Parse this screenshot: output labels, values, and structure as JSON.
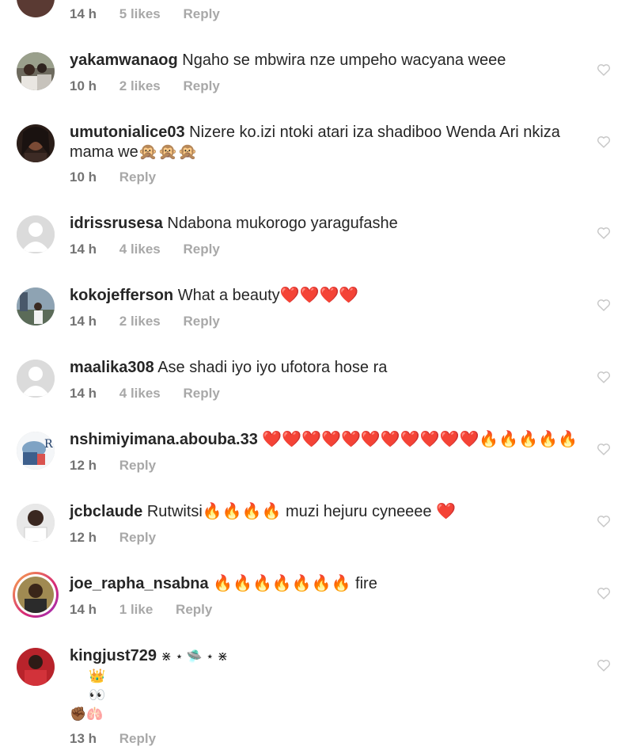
{
  "comments": [
    {
      "username": "",
      "text": "",
      "time": "14 h",
      "likes": "5 likes",
      "reply": "Reply"
    },
    {
      "username": "yakamwanaog",
      "text": "Ngaho se mbwira nze umpeho wacyana weee",
      "time": "10 h",
      "likes": "2 likes",
      "reply": "Reply"
    },
    {
      "username": "umutonialice03",
      "text": "Nizere ko.izi ntoki atari iza shadiboo Wenda Ari nkiza mama we🙊🙊🙊",
      "time": "10 h",
      "reply": "Reply"
    },
    {
      "username": "idrissrusesa",
      "text": "Ndabona mukorogo yaragufashe",
      "time": "14 h",
      "likes": "4 likes",
      "reply": "Reply"
    },
    {
      "username": "kokojefferson",
      "text": "What a beauty❤️❤️❤️❤️",
      "time": "14 h",
      "likes": "2 likes",
      "reply": "Reply"
    },
    {
      "username": "maalika308",
      "text": "Ase shadi iyo iyo ufotora hose ra",
      "time": "14 h",
      "likes": "4 likes",
      "reply": "Reply"
    },
    {
      "username": "nshimiyimana.abouba.33",
      "text": "❤️❤️❤️❤️❤️❤️❤️❤️❤️❤️❤️🔥🔥🔥🔥🔥",
      "time": "12 h",
      "reply": "Reply"
    },
    {
      "username": "jcbclaude",
      "text": "Rutwitsi🔥🔥🔥🔥 muzi hejuru cyneeee ❤️",
      "time": "12 h",
      "reply": "Reply"
    },
    {
      "username": "joe_rapha_nsabna",
      "text": "🔥🔥🔥🔥🔥🔥🔥 fire",
      "time": "14 h",
      "likes": "1 like",
      "reply": "Reply"
    },
    {
      "username": "kingjust729",
      "text": "⋇ ⋆ 🛸 ⋆ ⋇",
      "line2": "👑",
      "line3": "👀",
      "line4": "✊🏾🫁",
      "time": "13 h",
      "reply": "Reply"
    }
  ],
  "icons": {
    "like": "heart-outline-icon",
    "default_avatar": "default-avatar-icon"
  },
  "colors": {
    "text": "#262626",
    "meta": "#a8a8a8",
    "heart": "#c7c7c7"
  }
}
